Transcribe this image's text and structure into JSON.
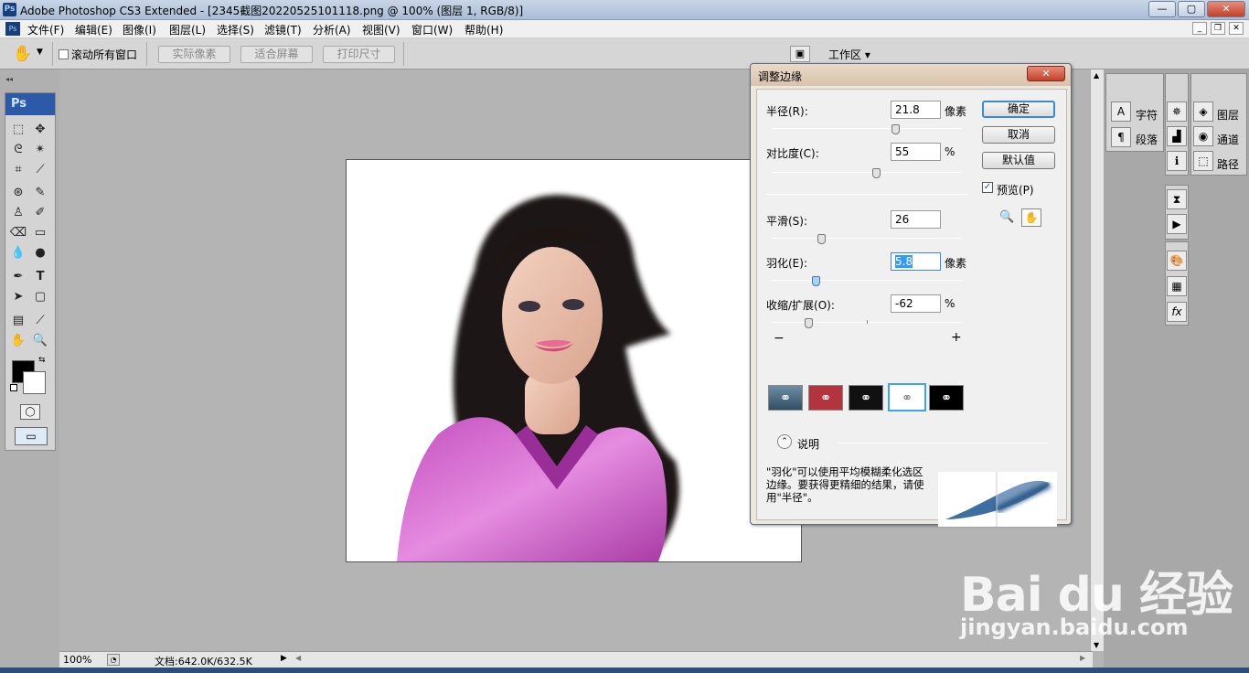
{
  "window": {
    "title": "Adobe Photoshop CS3 Extended - [2345截图20220525101118.png @ 100% (图层 1, RGB/8)]",
    "app_icon": "Ps",
    "controls": [
      "minimize-icon",
      "maximize-icon",
      "close-icon"
    ]
  },
  "menu": [
    "文件(F)",
    "编辑(E)",
    "图像(I)",
    "图层(L)",
    "选择(S)",
    "滤镜(T)",
    "分析(A)",
    "视图(V)",
    "窗口(W)",
    "帮助(H)"
  ],
  "options": {
    "scroll_all_label": "滚动所有窗口",
    "actual_pixels": "实际像素",
    "fit_screen": "适合屏幕",
    "print_size": "打印尺寸",
    "workspace": "工作区 ▾"
  },
  "toolbox": {
    "logo": "Ps"
  },
  "status": {
    "zoom": "100%",
    "doc": "文档:642.0K/632.5K"
  },
  "panels": {
    "char": "字符",
    "para": "段落",
    "layers": "图层",
    "channels": "通道",
    "paths": "路径"
  },
  "dialog": {
    "title": "调整边缘",
    "radius_label": "半径(R):",
    "radius_value": "21.8",
    "radius_unit": "像素",
    "radius_pos": 0.65,
    "contrast_label": "对比度(C):",
    "contrast_value": "55",
    "contrast_unit": "%",
    "contrast_pos": 0.55,
    "smooth_label": "平滑(S):",
    "smooth_value": "26",
    "smooth_pos": 0.26,
    "feather_label": "羽化(E):",
    "feather_value": "5.8",
    "feather_unit": "像素",
    "feather_pos": 0.23,
    "contract_label": "收缩/扩展(O):",
    "contract_value": "-62",
    "contract_unit": "%",
    "contract_pos": 0.19,
    "minus": "−",
    "plus": "+",
    "ok": "确定",
    "cancel": "取消",
    "default": "默认值",
    "preview": "预览(P)",
    "explain": "说明",
    "description": "\"羽化\"可以使用平均模糊柔化选区边缘。要获得更精细的结果，请使用\"半径\"。"
  },
  "watermark": {
    "big": "Bai du 经验",
    "small": "jingyan.baidu.com"
  }
}
